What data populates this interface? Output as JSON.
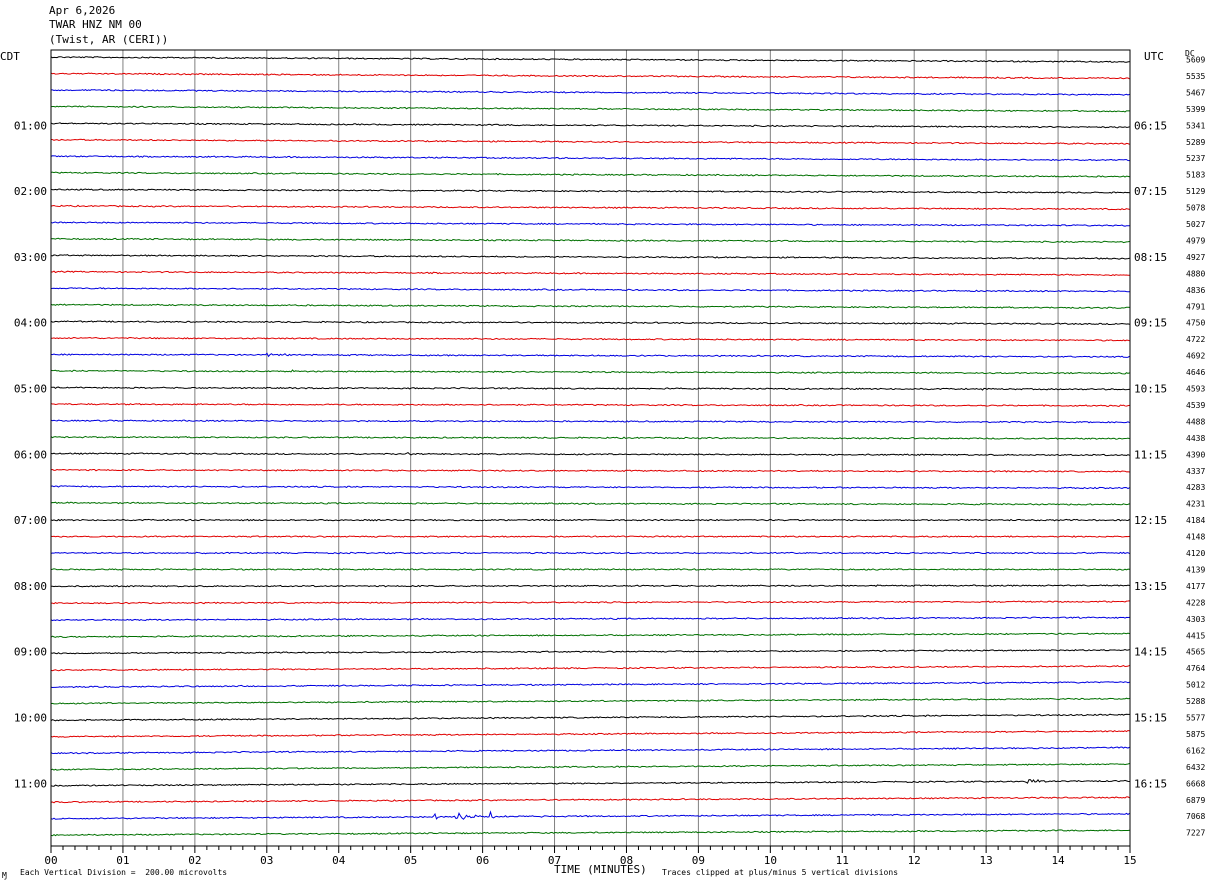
{
  "header": {
    "date": "Apr 6,2026",
    "station": "TWAR HNZ NM 00",
    "location": "(Twist, AR (CERI))"
  },
  "left_timezone": "CDT",
  "right_timezone": "UTC",
  "dc_label": "DC",
  "footer": {
    "scale_note": "Each Vertical Division =  200.00 microvolts",
    "clip_note": "Traces clipped at plus/minus 5 vertical divisions",
    "corner_mark": "Ɱ"
  },
  "colors": {
    "trace_cycle": [
      "#000000",
      "#e00000",
      "#0000e0",
      "#007000"
    ],
    "grid": "#808080",
    "frame": "#000000"
  },
  "chart_data": {
    "type": "line",
    "title": "",
    "xlabel": "TIME (MINUTES)",
    "ylabel": "",
    "xlim": [
      0,
      15
    ],
    "x_ticks": [
      "00",
      "01",
      "02",
      "03",
      "04",
      "05",
      "06",
      "07",
      "08",
      "09",
      "10",
      "11",
      "12",
      "13",
      "14",
      "15"
    ],
    "minutes_per_line": 15,
    "trace_count": 48,
    "grid": true,
    "left_hour_labels": [
      {
        "line": 4,
        "text": "01:00"
      },
      {
        "line": 8,
        "text": "02:00"
      },
      {
        "line": 12,
        "text": "03:00"
      },
      {
        "line": 16,
        "text": "04:00"
      },
      {
        "line": 20,
        "text": "05:00"
      },
      {
        "line": 24,
        "text": "06:00"
      },
      {
        "line": 28,
        "text": "07:00"
      },
      {
        "line": 32,
        "text": "08:00"
      },
      {
        "line": 36,
        "text": "09:00"
      },
      {
        "line": 40,
        "text": "10:00"
      },
      {
        "line": 44,
        "text": "11:00"
      }
    ],
    "right_hour_labels": [
      {
        "line": 4,
        "text": "06:15"
      },
      {
        "line": 8,
        "text": "07:15"
      },
      {
        "line": 12,
        "text": "08:15"
      },
      {
        "line": 16,
        "text": "09:15"
      },
      {
        "line": 20,
        "text": "10:15"
      },
      {
        "line": 24,
        "text": "11:15"
      },
      {
        "line": 28,
        "text": "12:15"
      },
      {
        "line": 32,
        "text": "13:15"
      },
      {
        "line": 36,
        "text": "14:15"
      },
      {
        "line": 40,
        "text": "15:15"
      },
      {
        "line": 44,
        "text": "16:15"
      }
    ],
    "dc_offsets": [
      "5609",
      "5535",
      "5467",
      "5399",
      "5341",
      "5289",
      "5237",
      "5183",
      "5129",
      "5078",
      "5027",
      "4979",
      "4927",
      "4880",
      "4836",
      "4791",
      "4750",
      "4722",
      "4692",
      "4646",
      "4593",
      "4539",
      "4488",
      "4438",
      "4390",
      "4337",
      "4283",
      "4231",
      "4184",
      "4148",
      "4120",
      "4139",
      "4177",
      "4228",
      "4303",
      "4415",
      "4565",
      "4764",
      "5012",
      "5288",
      "5577",
      "5875",
      "6162",
      "6432",
      "6668",
      "6879",
      "7068",
      "7227"
    ],
    "line_tilt_divisions": [
      -0.3,
      -0.3,
      -0.3,
      -0.3,
      -0.25,
      -0.25,
      -0.25,
      -0.25,
      -0.2,
      -0.2,
      -0.2,
      -0.2,
      -0.2,
      -0.2,
      -0.2,
      -0.2,
      -0.15,
      -0.15,
      -0.15,
      -0.15,
      -0.1,
      -0.1,
      -0.1,
      -0.1,
      -0.1,
      -0.1,
      -0.1,
      -0.1,
      0,
      0,
      0,
      0,
      0.05,
      0.1,
      0.15,
      0.2,
      0.2,
      0.25,
      0.3,
      0.3,
      0.35,
      0.35,
      0.35,
      0.35,
      0.3,
      0.3,
      0.3,
      0.3
    ],
    "events": [
      {
        "line": 18,
        "minute": 3.0,
        "amplitude_div": 0.25,
        "duration_min": 0.6
      },
      {
        "line": 19,
        "minute": 3.35,
        "amplitude_div": 0.35,
        "duration_min": 0.1
      },
      {
        "line": 19,
        "minute": 7.7,
        "amplitude_div": 0.35,
        "duration_min": 0.1
      },
      {
        "line": 20,
        "minute": 12.9,
        "amplitude_div": 0.25,
        "duration_min": 0.1
      },
      {
        "line": 24,
        "minute": 4.95,
        "amplitude_div": 0.35,
        "duration_min": 0.1
      },
      {
        "line": 44,
        "minute": 13.55,
        "amplitude_div": 0.55,
        "duration_min": 0.4
      },
      {
        "line": 46,
        "minute": 5.3,
        "amplitude_div": 1.4,
        "duration_min": 0.1
      },
      {
        "line": 46,
        "minute": 5.6,
        "amplitude_div": 0.6,
        "duration_min": 0.9
      },
      {
        "line": 46,
        "minute": 6.1,
        "amplitude_div": 0.8,
        "duration_min": 0.1
      },
      {
        "line": 46,
        "minute": 6.8,
        "amplitude_div": 0.5,
        "duration_min": 0.1
      }
    ]
  }
}
